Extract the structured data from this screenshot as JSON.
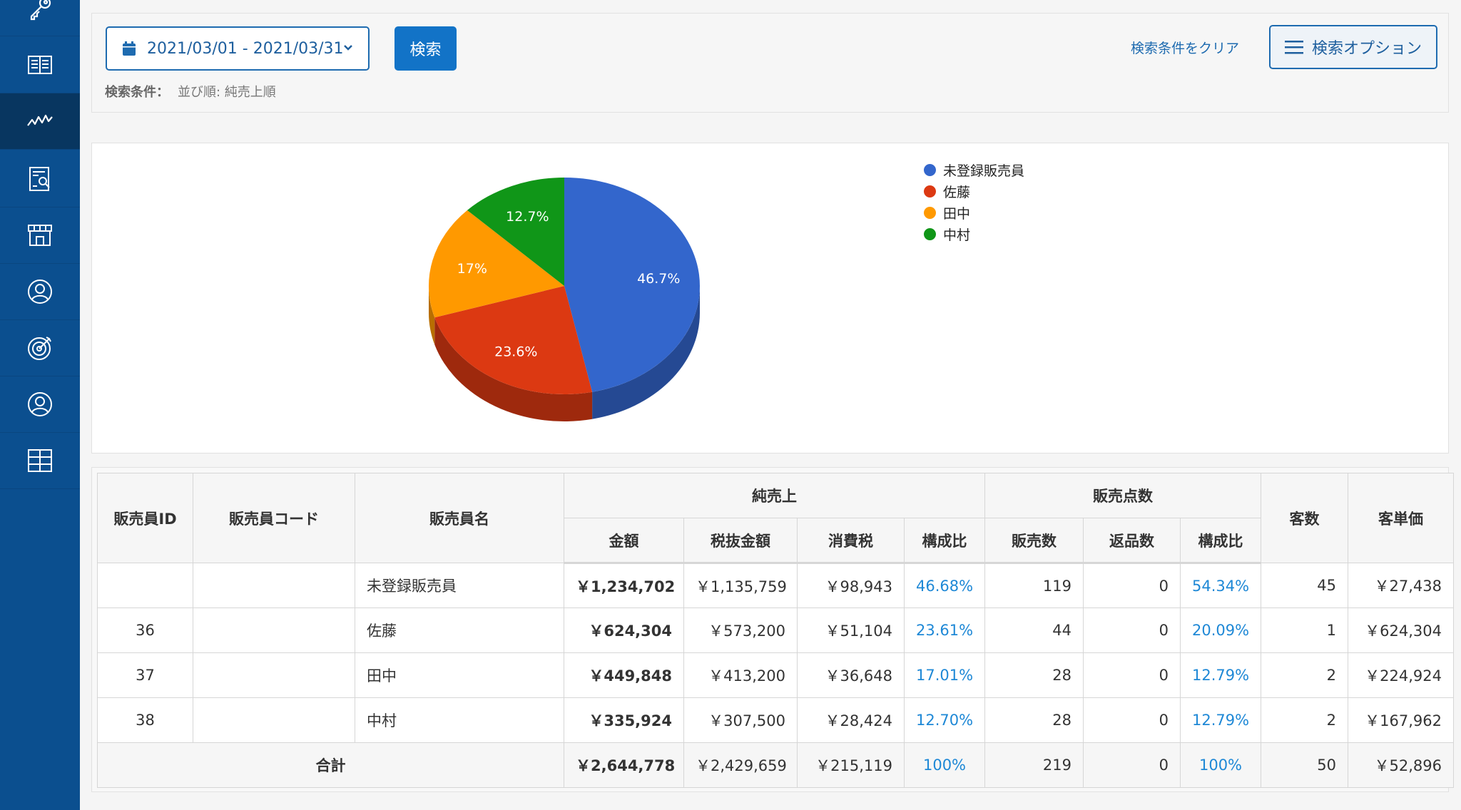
{
  "search": {
    "date_range": "2021/03/01 - 2021/03/31",
    "search_label": "検索",
    "clear_label": "検索条件をクリア",
    "options_label": "検索オプション",
    "conditions_label": "検索条件：",
    "conditions_value": "並び順: 純売上順"
  },
  "colors": {
    "sidebar": "#0b4f8f",
    "accent": "#1273c7",
    "link": "#1e88d6"
  },
  "sidebar": {
    "items": [
      {
        "icon": "key-icon"
      },
      {
        "icon": "book-icon"
      },
      {
        "icon": "chart-line-icon",
        "active": true
      },
      {
        "icon": "report-search-icon"
      },
      {
        "icon": "store-icon"
      },
      {
        "icon": "user-circle-icon"
      },
      {
        "icon": "target-icon"
      },
      {
        "icon": "user-circle-icon"
      },
      {
        "icon": "grid-icon"
      }
    ]
  },
  "chart_data": {
    "type": "pie",
    "categories": [
      "未登録販売員",
      "佐藤",
      "田中",
      "中村"
    ],
    "values": [
      46.7,
      23.6,
      17,
      12.7
    ],
    "labels": [
      "46.7%",
      "23.6%",
      "17%",
      "12.7%"
    ],
    "colors": [
      "#3366cc",
      "#dc3912",
      "#ff9900",
      "#109618"
    ],
    "legend": "right"
  },
  "table": {
    "headers": {
      "id": "販売員ID",
      "code": "販売員コード",
      "name": "販売員名",
      "net_sales": "純売上",
      "amount": "金額",
      "pretax": "税抜金額",
      "tax": "消費税",
      "ratio": "構成比",
      "units": "販売点数",
      "sold": "販売数",
      "returned": "返品数",
      "units_ratio": "構成比",
      "customers": "客数",
      "avg": "客単価"
    },
    "rows": [
      {
        "id": "",
        "code": "",
        "name": "未登録販売員",
        "amount": "￥1,234,702",
        "pretax": "￥1,135,759",
        "tax": "￥98,943",
        "ratio": "46.68%",
        "sold": "119",
        "returned": "0",
        "units_ratio": "54.34%",
        "customers": "45",
        "avg": "￥27,438"
      },
      {
        "id": "36",
        "code": "",
        "name": "佐藤",
        "amount": "￥624,304",
        "pretax": "￥573,200",
        "tax": "￥51,104",
        "ratio": "23.61%",
        "sold": "44",
        "returned": "0",
        "units_ratio": "20.09%",
        "customers": "1",
        "avg": "￥624,304"
      },
      {
        "id": "37",
        "code": "",
        "name": "田中",
        "amount": "￥449,848",
        "pretax": "￥413,200",
        "tax": "￥36,648",
        "ratio": "17.01%",
        "sold": "28",
        "returned": "0",
        "units_ratio": "12.79%",
        "customers": "2",
        "avg": "￥224,924"
      },
      {
        "id": "38",
        "code": "",
        "name": "中村",
        "amount": "￥335,924",
        "pretax": "￥307,500",
        "tax": "￥28,424",
        "ratio": "12.70%",
        "sold": "28",
        "returned": "0",
        "units_ratio": "12.79%",
        "customers": "2",
        "avg": "￥167,962"
      }
    ],
    "total": {
      "label": "合計",
      "amount": "￥2,644,778",
      "pretax": "￥2,429,659",
      "tax": "￥215,119",
      "ratio": "100%",
      "sold": "219",
      "returned": "0",
      "units_ratio": "100%",
      "customers": "50",
      "avg": "￥52,896"
    }
  }
}
